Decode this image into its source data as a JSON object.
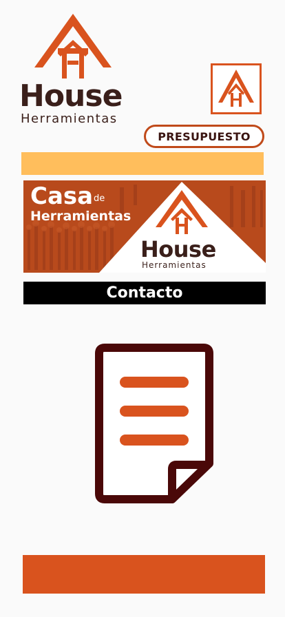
{
  "logo": {
    "brand_name": "House",
    "brand_sub": "Herramientas"
  },
  "actions": {
    "presupuesto_label": "PRESUPUESTO"
  },
  "banner": {
    "casa": "Casa",
    "de": "de",
    "herramientas": "Herramientas",
    "brand_name": "House",
    "brand_sub": "Herramientas"
  },
  "nav": {
    "contacto_label": "Contacto"
  },
  "icons": {
    "logo_mark": "house-roof-logo-icon",
    "small_logo": "house-roof-logo-icon",
    "document": "document-icon"
  },
  "colors": {
    "brand_orange": "#d9531e",
    "brand_dark": "#3a1f1a",
    "yellow_bar": "#ffbe5c",
    "contact_bar": "#000000",
    "document_outline": "#4a0808",
    "background": "#fafafa"
  }
}
